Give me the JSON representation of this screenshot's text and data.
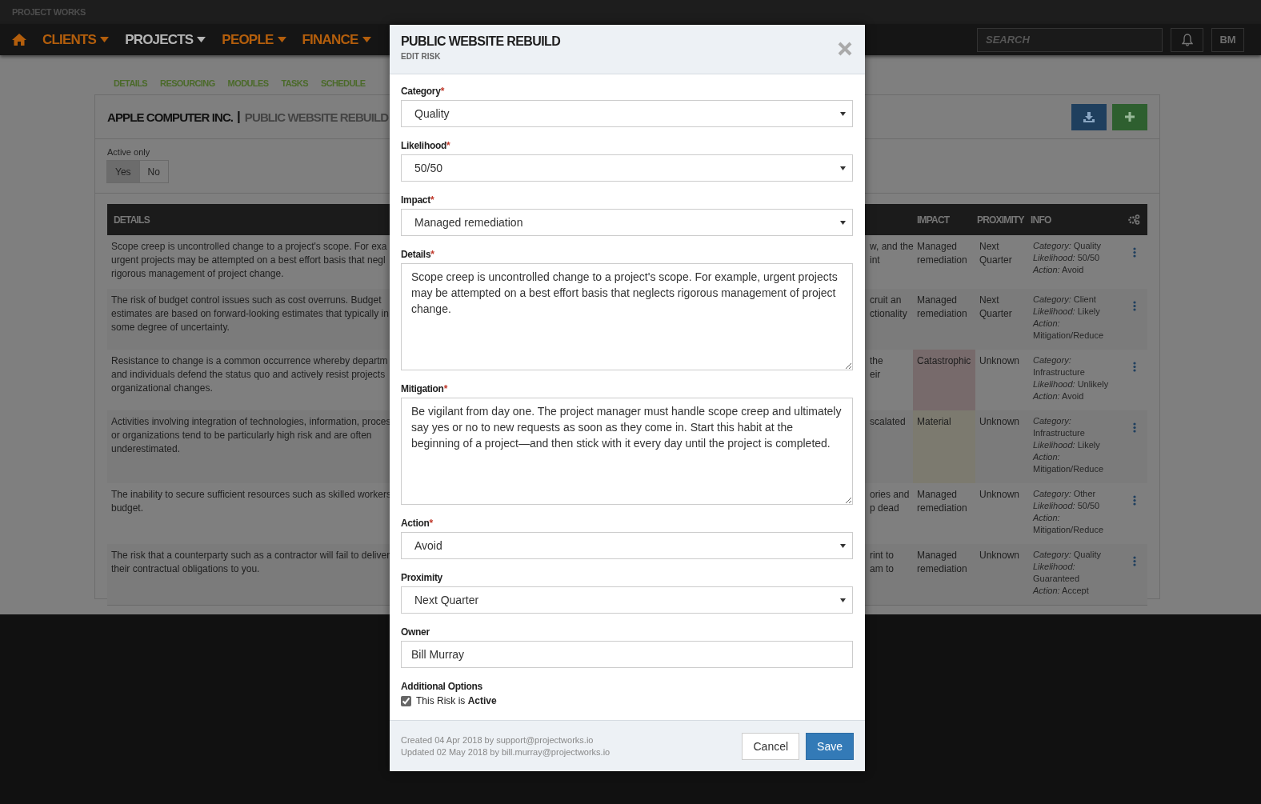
{
  "app_title": "PROJECT WORKS",
  "nav": [
    {
      "label": "CLIENTS",
      "selected": false
    },
    {
      "label": "PROJECTS",
      "selected": true
    },
    {
      "label": "PEOPLE",
      "selected": false
    },
    {
      "label": "FINANCE",
      "selected": false
    }
  ],
  "search": {
    "placeholder": "SEARCH"
  },
  "user_initials": "BM",
  "subnav": [
    "DETAILS",
    "RESOURCING",
    "MODULES",
    "TASKS",
    "SCHEDULE"
  ],
  "card": {
    "client": "APPLE COMPUTER INC.",
    "separator": "|",
    "project": "PUBLIC WEBSITE REBUILD"
  },
  "filter": {
    "label": "Active only",
    "options": [
      {
        "label": "Yes",
        "selected": true
      },
      {
        "label": "No",
        "selected": false
      }
    ]
  },
  "table": {
    "columns": [
      "DETAILS",
      "IMPACT",
      "PROXIMITY",
      "INFO"
    ],
    "rows": [
      {
        "details": [
          "Scope creep is uncontrolled change to a project's scope. For exa",
          "urgent projects may be attempted on a best effort basis that negl",
          "rigorous management of project change."
        ],
        "column_2": [
          "w, and the",
          "int"
        ],
        "impact": "Managed remediation",
        "proximity": "Next Quarter",
        "info": [
          "*Category:* Quality",
          "*Likelihood:* 50/50",
          "*Action:* Avoid"
        ]
      },
      {
        "details": [
          "The risk of budget control issues such as cost overruns. Budget",
          "estimates are based on forward-looking estimates that typically in",
          "some degree of uncertainty."
        ],
        "column_2": [
          "cruit an",
          "ctionality"
        ],
        "impact": "Managed remediation",
        "proximity": "Next Quarter",
        "info": [
          "*Category:* Client",
          "*Likelihood:* Likely",
          "*Action:* Mitigation/Reduce"
        ]
      },
      {
        "details": [
          "Resistance to change is a common occurrence whereby departm",
          "and individuals defend the status quo and actively resist projects",
          "organizational changes."
        ],
        "column_2": [
          "the",
          "eir"
        ],
        "impact": "Catastrophic",
        "color": "#776a6b",
        "proximity": "Unknown",
        "info": [
          "*Category:* Infrastructure",
          "*Likelihood:* Unlikely",
          "*Action:* Avoid"
        ]
      },
      {
        "details": [
          "Activities involving integration of technologies, information, proces",
          "or organizations tend to be particularly high risk and are often",
          "underestimated."
        ],
        "column_2": [
          "scalated"
        ],
        "impact": "Material",
        "color": "#7c7a6f",
        "proximity": "Unknown",
        "info": [
          "*Category:* Infrastructure",
          "*Likelihood:* Likely",
          "*Action:* Mitigation/Reduce"
        ]
      },
      {
        "details": [
          "The inability to secure sufficient resources such as skilled workers",
          "budget."
        ],
        "column_2": [
          "ories and",
          "p dead"
        ],
        "impact": "Managed remediation",
        "proximity": "Unknown",
        "info": [
          "*Category:* Other",
          "*Likelihood:* 50/50",
          "*Action:* Mitigation/Reduce"
        ]
      },
      {
        "details": [
          "The risk that a counterparty such as a contractor will fail to deliver",
          "their contractual obligations to you."
        ],
        "column_2": [
          "rint to",
          "am to"
        ],
        "impact": "Managed remediation",
        "proximity": "Unknown",
        "info": [
          "*Category:* Quality",
          "*Likelihood:* Guaranteed",
          "*Action:* Accept"
        ]
      }
    ]
  },
  "modal": {
    "title": "PUBLIC WEBSITE REBUILD",
    "subtitle": "EDIT RISK",
    "fields": [
      {
        "kind": "select",
        "label": "Category",
        "mark": "*",
        "value": "Quality"
      },
      {
        "kind": "select",
        "label": "Likelihood",
        "mark": "*",
        "value": "50/50"
      },
      {
        "kind": "select",
        "label": "Impact",
        "mark": "*",
        "value": "Managed remediation"
      },
      {
        "kind": "textarea",
        "label": "Details",
        "mark": "*",
        "value": "Scope creep is uncontrolled change to a project's scope. For example, urgent projects may be attempted on a best effort basis that neglects rigorous management of project change."
      },
      {
        "kind": "textarea",
        "label": "Mitigation",
        "mark": "*",
        "value": "Be vigilant from day one. The project manager must handle scope creep and ultimately say yes or no to new requests as soon as they come in. Start this habit at the beginning of a project—and then stick with it every day until the project is completed."
      },
      {
        "kind": "select",
        "label": "Action",
        "mark": "*",
        "value": "Avoid"
      },
      {
        "kind": "select",
        "label": "Proximity",
        "value": "Next Quarter"
      },
      {
        "kind": "input",
        "label": "Owner",
        "value": "Bill Murray"
      }
    ],
    "options_label": "Additional Options",
    "active_option": {
      "label": "This Risk is **Active**",
      "checked": true
    },
    "created": "Created 04 Apr 2018 by support@projectworks.io",
    "updated": "Updated 02 May 2018 by bill.murray@projectworks.io",
    "buttons": [
      {
        "kind": "secondary",
        "label": "Cancel"
      },
      {
        "kind": "primary",
        "label": "Save"
      }
    ]
  }
}
